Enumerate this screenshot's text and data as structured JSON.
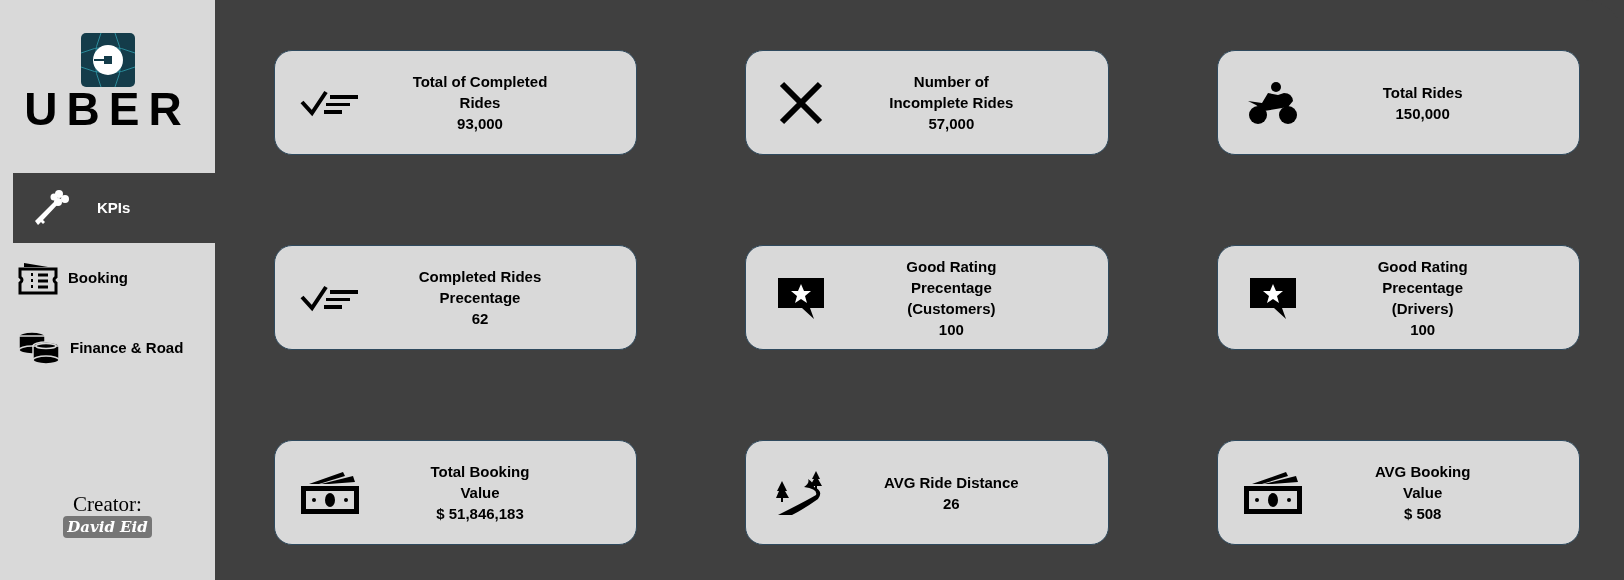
{
  "sidebar": {
    "logo": {
      "wordmark": "UBER"
    },
    "items": [
      {
        "label": "KPIs",
        "selected": true
      },
      {
        "label": "Booking",
        "selected": false
      },
      {
        "label": "Finance & Road",
        "selected": false
      }
    ],
    "creator": {
      "label": "Creator:",
      "name": "David Eid"
    }
  },
  "cards": [
    {
      "label": "Total of Completed\nRides",
      "value": "93,000"
    },
    {
      "label": "Number of\nIncomplete Rides",
      "value": "57,000"
    },
    {
      "label": "Total Rides",
      "value": "150,000"
    },
    {
      "label": "Completed Rides\nPrecentage",
      "value": "62"
    },
    {
      "label": "Good Rating\nPrecentage\n(Customers)",
      "value": "100"
    },
    {
      "label": "Good Rating\nPrecentage\n(Drivers)",
      "value": "100"
    },
    {
      "label": "Total Booking\nValue",
      "value": "$ 51,846,183"
    },
    {
      "label": "AVG Ride Distance",
      "value": "26"
    },
    {
      "label": "AVG Booking\nValue",
      "value": "$ 508"
    }
  ]
}
